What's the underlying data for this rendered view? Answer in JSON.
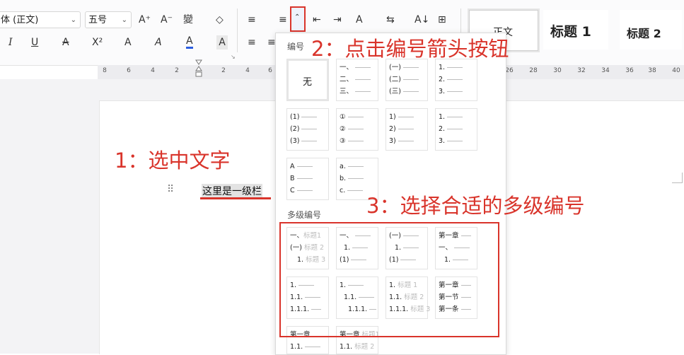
{
  "toolbar": {
    "font_name": "体 (正文)",
    "font_size": "五号",
    "row1_icons": [
      "A⁺",
      "A⁻",
      "變",
      "◇"
    ],
    "row2_icons": [
      "I",
      "U",
      "A",
      "X²",
      "A",
      "A",
      "A",
      "A"
    ],
    "list_icons": [
      "≡",
      "≡",
      "⇤",
      "⇥",
      "A",
      "⇆",
      "A↓",
      "⊞"
    ],
    "align_icons": [
      "≡",
      "≡"
    ],
    "styles": [
      "正文",
      "标题 1",
      "标题 2"
    ],
    "colors": {
      "accent": "#2b5de0",
      "annotation": "#d9342b"
    }
  },
  "ruler": {
    "ticks_left": [
      "8",
      "6",
      "4",
      "2"
    ],
    "ticks_right": [
      "2",
      "4",
      "6"
    ],
    "ticks_far": [
      "26",
      "28",
      "30",
      "32",
      "34",
      "36",
      "38",
      "40"
    ]
  },
  "document": {
    "text": "这里是一级栏",
    "handle_icon": "drag-handle-icon"
  },
  "annotations": {
    "step1": "1：选中文字",
    "step2": "2：点击编号箭头按钮",
    "step3": "3：选择合适的多级编号"
  },
  "numbering": {
    "title": "编号",
    "none_label": "无",
    "tiles": [
      {
        "lines": [
          "一、",
          "二、",
          "三、"
        ]
      },
      {
        "lines": [
          "(一)",
          "(二)",
          "(三)"
        ]
      },
      {
        "lines": [
          "1.",
          "2.",
          "3."
        ]
      },
      {
        "lines": [
          "(1)",
          "(2)",
          "(3)"
        ]
      },
      {
        "lines": [
          "①",
          "②",
          "③"
        ]
      },
      {
        "lines": [
          "1)",
          "2)",
          "3)"
        ]
      },
      {
        "lines": [
          "1.",
          "2.",
          "3."
        ]
      },
      {
        "lines": [
          "A",
          "B",
          "C"
        ]
      },
      {
        "lines": [
          "a.",
          "b.",
          "c."
        ]
      }
    ]
  },
  "multilevel": {
    "title": "多级编号",
    "tiles": [
      {
        "lines": [
          [
            "一、",
            "标题1"
          ],
          [
            "(一)",
            "标题 2"
          ],
          [
            "1.",
            "标题 3"
          ]
        ]
      },
      {
        "lines": [
          [
            "一、",
            ""
          ],
          [
            "1.",
            ""
          ],
          [
            "(1)",
            ""
          ]
        ]
      },
      {
        "lines": [
          [
            "(一)",
            ""
          ],
          [
            "1.",
            ""
          ],
          [
            "(1)",
            ""
          ]
        ]
      },
      {
        "lines": [
          [
            "第一章",
            ""
          ],
          [
            "一、",
            ""
          ],
          [
            "1.",
            ""
          ]
        ]
      },
      {
        "lines": [
          [
            "1.",
            ""
          ],
          [
            "1.1.",
            ""
          ],
          [
            "1.1.1.",
            ""
          ]
        ]
      },
      {
        "lines": [
          [
            "1.",
            ""
          ],
          [
            "1.1.",
            ""
          ],
          [
            "1.1.1.",
            ""
          ]
        ]
      },
      {
        "lines": [
          [
            "1.",
            "标题 1"
          ],
          [
            "1.1.",
            "标题 2"
          ],
          [
            "1.1.1.",
            "标题 3"
          ]
        ]
      },
      {
        "lines": [
          [
            "第一章",
            ""
          ],
          [
            "第一节",
            ""
          ],
          [
            "第一条",
            ""
          ]
        ]
      },
      {
        "lines": [
          [
            "第一章",
            ""
          ],
          [
            "1.1.",
            ""
          ]
        ]
      },
      {
        "lines": [
          [
            "第一章",
            "标题1"
          ],
          [
            "1.1.",
            "标题 2"
          ]
        ]
      }
    ]
  }
}
